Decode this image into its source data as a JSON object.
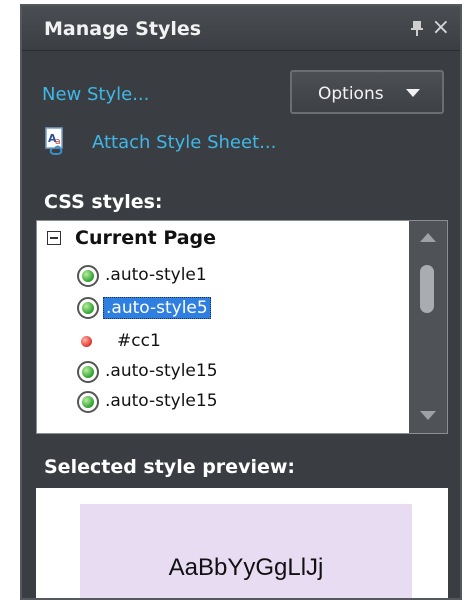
{
  "panel": {
    "title": "Manage Styles",
    "pin_icon": "pin-icon",
    "close_glyph": "×"
  },
  "toolbar": {
    "new_style": "New Style...",
    "options": "Options",
    "attach_icon": "attach-stylesheet-icon",
    "attach_style_sheet": "Attach Style Sheet..."
  },
  "css_styles": {
    "label": "CSS styles:",
    "group": "Current Page",
    "items": [
      {
        "name": ".auto-style1",
        "icon": "green-circle-icon",
        "selected": false
      },
      {
        "name": ".auto-style5",
        "icon": "green-circle-icon",
        "selected": true
      },
      {
        "name": "#cc1",
        "icon": "red-dot-icon",
        "selected": false
      },
      {
        "name": ".auto-style15",
        "icon": "green-circle-icon",
        "selected": false
      },
      {
        "name": ".auto-style15",
        "icon": "green-circle-icon",
        "selected": false
      }
    ]
  },
  "preview": {
    "label": "Selected style preview:",
    "sample_text": "AaBbYyGgLlJj",
    "background_color": "#e8dcf2"
  },
  "colors": {
    "panel_bg": "#3a3e42",
    "link": "#3fb7e8",
    "selection": "#2f7fe0"
  }
}
